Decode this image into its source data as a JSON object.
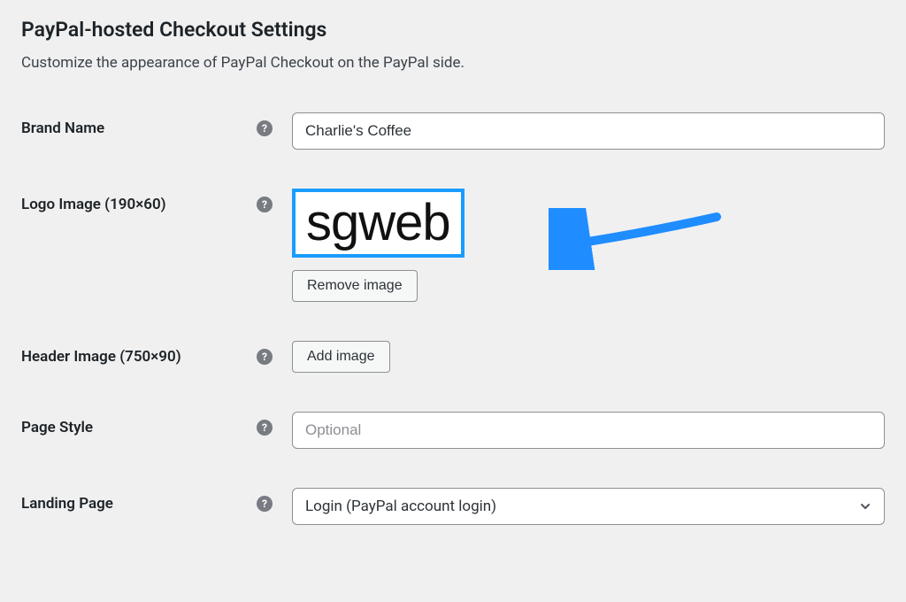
{
  "section_title": "PayPal-hosted Checkout Settings",
  "subtitle": "Customize the appearance of PayPal Checkout on the PayPal side.",
  "fields": {
    "brand_name": {
      "label": "Brand Name",
      "value": "Charlie's Coffee"
    },
    "logo_image": {
      "label": "Logo Image (190×60)",
      "preview_text": "sgweb",
      "remove_btn": "Remove image"
    },
    "header_image": {
      "label": "Header Image (750×90)",
      "add_btn": "Add image"
    },
    "page_style": {
      "label": "Page Style",
      "placeholder": "Optional",
      "value": ""
    },
    "landing_page": {
      "label": "Landing Page",
      "selected": "Login (PayPal account login)"
    }
  },
  "colors": {
    "highlight": "#1a9cff",
    "arrow": "#1f8dff"
  }
}
